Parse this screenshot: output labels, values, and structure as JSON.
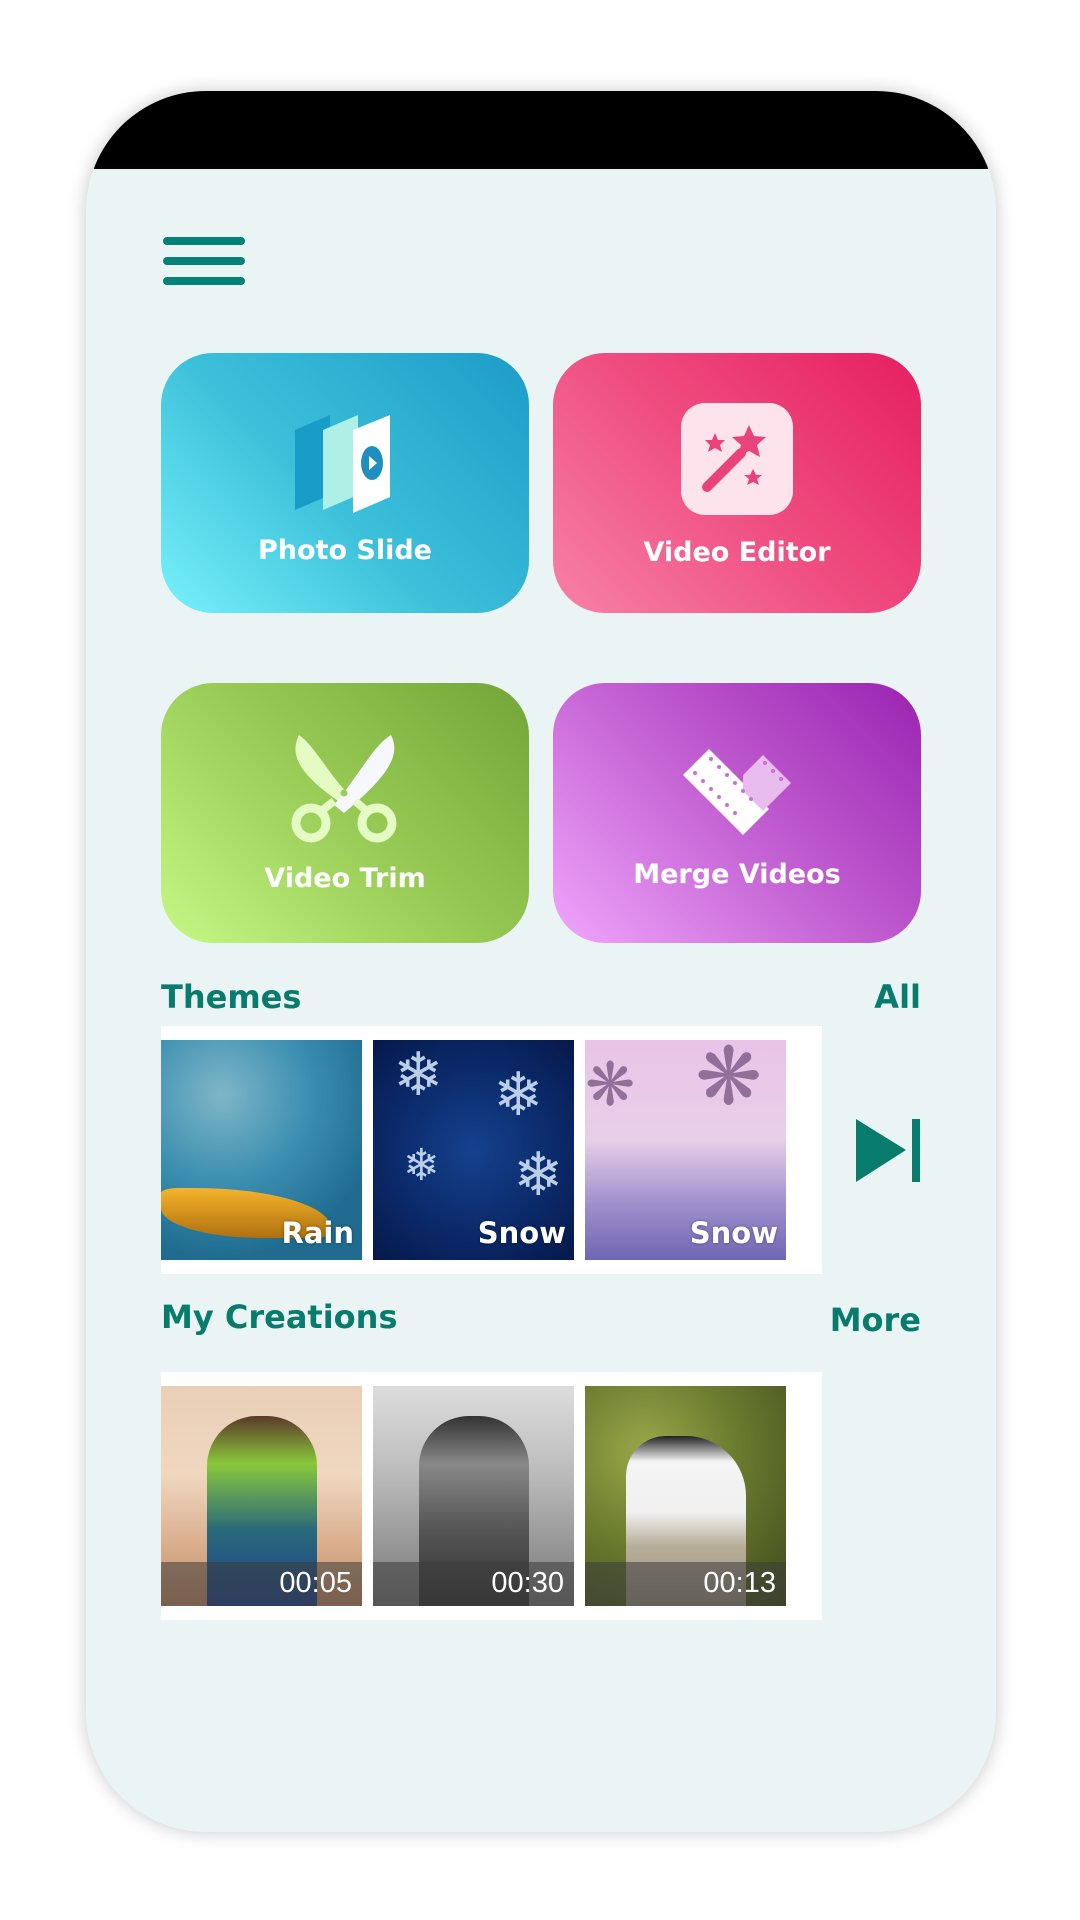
{
  "header": {
    "menu_icon": "hamburger-menu-icon"
  },
  "features": [
    {
      "label": "Photo Slide",
      "icon": "photo-slides-icon",
      "colors": [
        "#78f1fa",
        "#1c9cc8"
      ]
    },
    {
      "label": "Video Editor",
      "icon": "magic-wand-icon",
      "colors": [
        "#f782a8",
        "#e61f60"
      ]
    },
    {
      "label": "Video Trim",
      "icon": "scissors-icon",
      "colors": [
        "#c5f885",
        "#72a536"
      ]
    },
    {
      "label": "Merge Videos",
      "icon": "film-heart-icon",
      "colors": [
        "#f0a6fb",
        "#9a23b0"
      ]
    }
  ],
  "themes": {
    "title": "Themes",
    "link": "All",
    "items": [
      {
        "label": "Rain"
      },
      {
        "label": "Snow"
      },
      {
        "label": "Snow"
      }
    ],
    "next_icon": "skip-next-icon"
  },
  "creations": {
    "title": "My Creations",
    "link": "More",
    "items": [
      {
        "duration": "00:05"
      },
      {
        "duration": "00:30"
      },
      {
        "duration": "00:13"
      }
    ]
  },
  "colors": {
    "accent": "#077c6c",
    "background": "#eaf4f5"
  }
}
